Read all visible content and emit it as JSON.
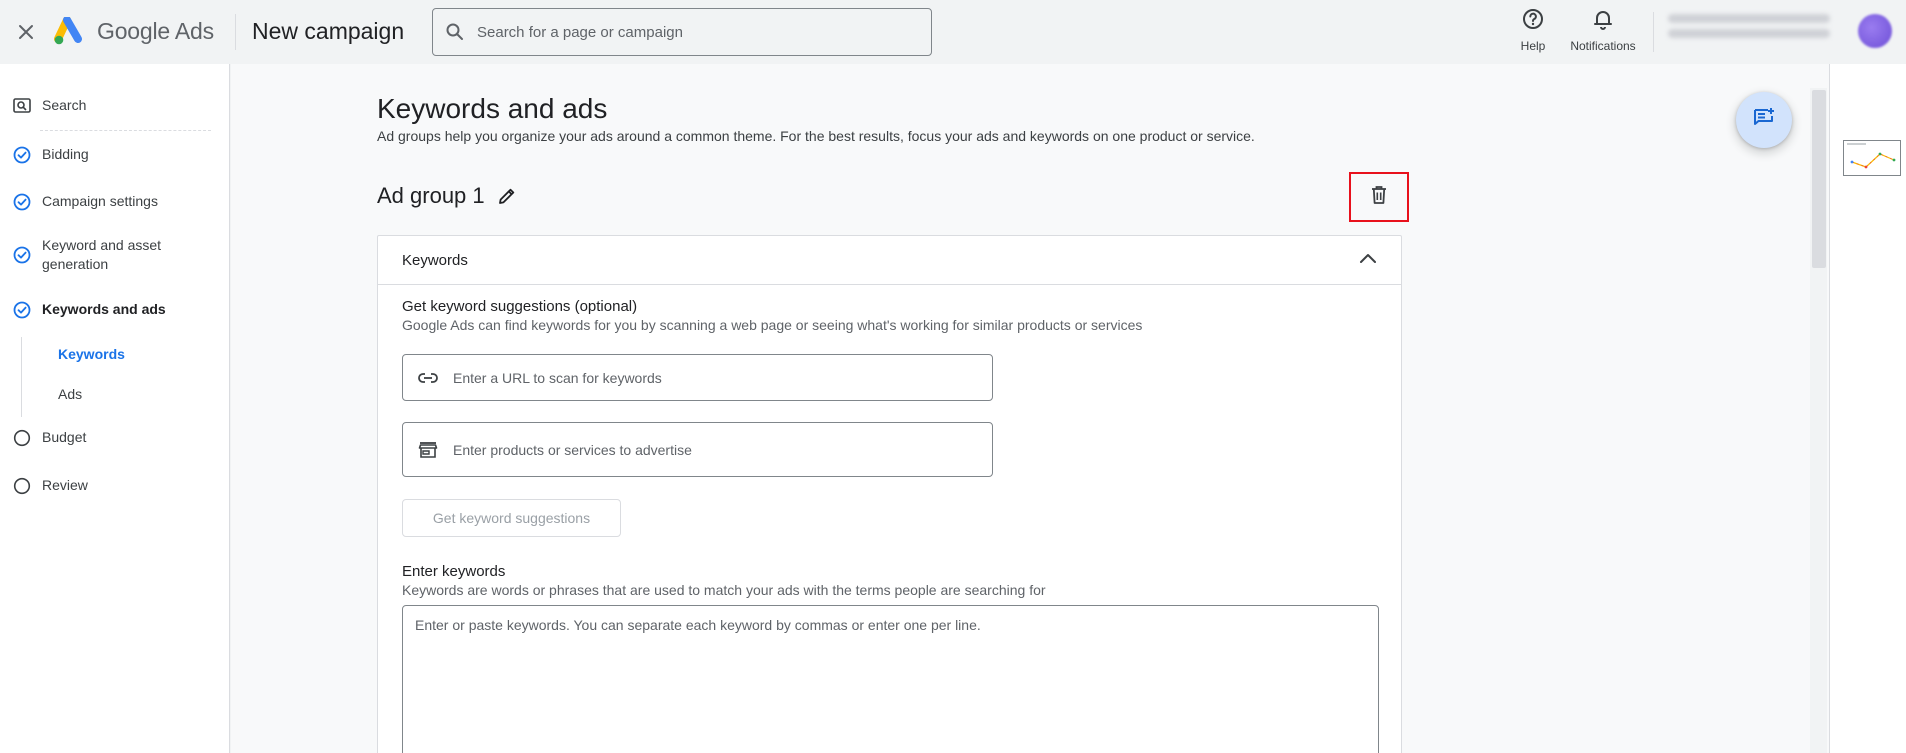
{
  "topbar": {
    "brand": "Google Ads",
    "title": "New campaign",
    "search_placeholder": "Search for a page or campaign",
    "help_label": "Help",
    "notifications_label": "Notifications"
  },
  "sidebar": {
    "items": [
      {
        "label": "Search",
        "state": "search"
      },
      {
        "label": "Bidding",
        "state": "done"
      },
      {
        "label": "Campaign settings",
        "state": "done"
      },
      {
        "label": "Keyword and asset generation",
        "state": "done"
      },
      {
        "label": "Keywords and ads",
        "state": "current"
      },
      {
        "label": "Budget",
        "state": "todo"
      },
      {
        "label": "Review",
        "state": "todo"
      }
    ],
    "subitems": [
      {
        "label": "Keywords",
        "active": true
      },
      {
        "label": "Ads",
        "active": false
      }
    ]
  },
  "main": {
    "title": "Keywords and ads",
    "subtitle": "Ad groups help you organize your ads around a common theme. For the best results, focus your ads and keywords on one product or service.",
    "ad_group_title": "Ad group 1",
    "keywords_card": {
      "header": "Keywords",
      "suggest_title": "Get keyword suggestions (optional)",
      "suggest_desc": "Google Ads can find keywords for you by scanning a web page or seeing what's working for similar products or services",
      "url_placeholder": "Enter a URL to scan for keywords",
      "products_placeholder": "Enter products or services to advertise",
      "suggest_button": "Get keyword suggestions",
      "enter_title": "Enter keywords",
      "enter_desc": "Keywords are words or phrases that are used to match your ads with the terms people are searching for",
      "keywords_placeholder": "Enter or paste keywords. You can separate each keyword by commas or enter one per line."
    }
  },
  "colors": {
    "accent": "#1a73e8",
    "highlight_box": "#e8111c",
    "fab_bg": "#d2e3fc"
  }
}
